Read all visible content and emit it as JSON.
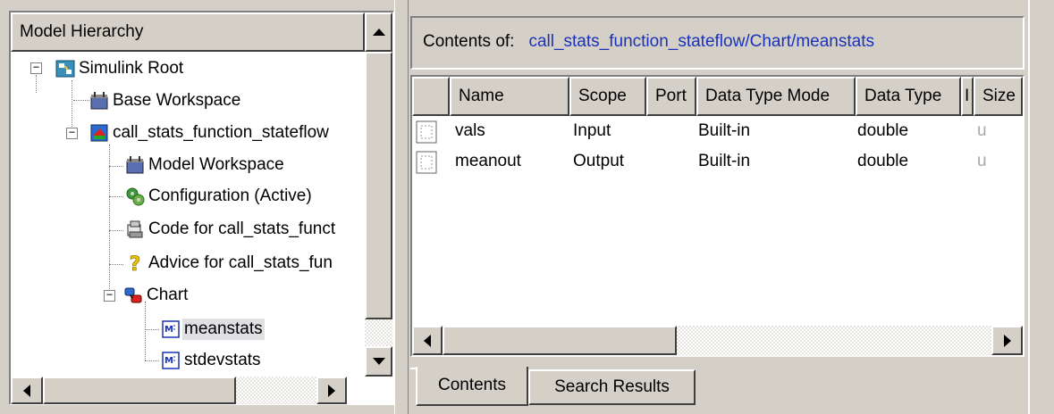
{
  "tree": {
    "header": "Model Hierarchy",
    "items": [
      {
        "label": "Simulink Root",
        "icon": "simulink-root-icon"
      },
      {
        "label": "Base Workspace",
        "icon": "workspace-icon"
      },
      {
        "label": "call_stats_function_stateflow",
        "icon": "model-icon"
      },
      {
        "label": "Model Workspace",
        "icon": "workspace-icon"
      },
      {
        "label": "Configuration (Active)",
        "icon": "configuration-icon"
      },
      {
        "label": "Code for call_stats_funct",
        "icon": "code-icon"
      },
      {
        "label": "Advice for call_stats_fun",
        "icon": "advice-icon"
      },
      {
        "label": "Chart",
        "icon": "chart-icon"
      },
      {
        "label": "meanstats",
        "icon": "matlab-function-icon"
      },
      {
        "label": "stdevstats",
        "icon": "matlab-function-icon"
      }
    ]
  },
  "contents": {
    "label": "Contents of:",
    "path": "call_stats_function_stateflow/Chart/meanstats"
  },
  "table": {
    "columns": [
      "Name",
      "Scope",
      "Port",
      "Data Type Mode",
      "Data Type",
      "I",
      "Size"
    ],
    "rows": [
      {
        "name": "vals",
        "scope": "Input",
        "port": "",
        "mode": "Built-in",
        "type": "double",
        "extra": "u",
        "size": ""
      },
      {
        "name": "meanout",
        "scope": "Output",
        "port": "",
        "mode": "Built-in",
        "type": "double",
        "extra": "u",
        "size": ""
      }
    ]
  },
  "tabs": [
    "Contents",
    "Search Results"
  ]
}
